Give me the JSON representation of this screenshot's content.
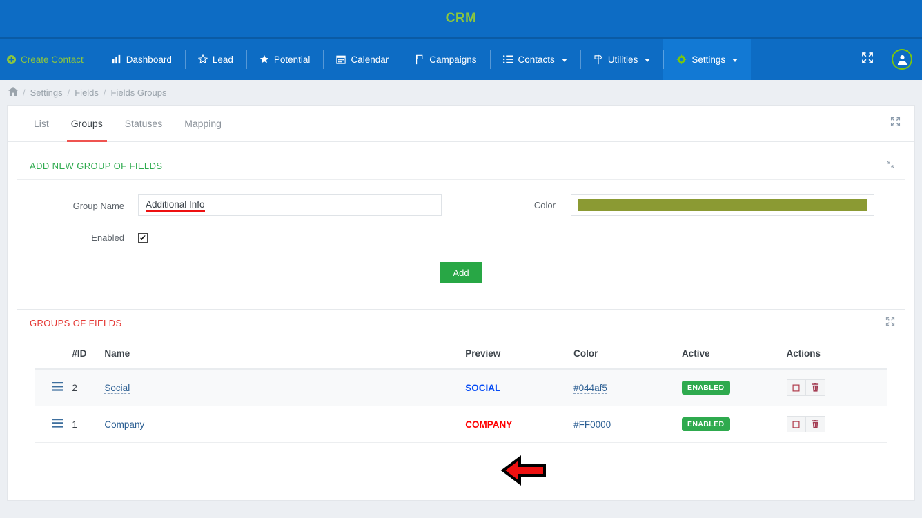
{
  "header": {
    "brand": "CRM",
    "brand_color": "#8cc63e",
    "bg_color": "#0d6cc4"
  },
  "nav": {
    "items": [
      {
        "label": "Create Contact",
        "icon": "plus-circle-icon",
        "active": false,
        "highlight": true
      },
      {
        "label": "Dashboard",
        "icon": "bar-chart-icon",
        "active": false
      },
      {
        "label": "Lead",
        "icon": "star-outline-icon",
        "active": false
      },
      {
        "label": "Potential",
        "icon": "star-filled-icon",
        "active": false
      },
      {
        "label": "Calendar",
        "icon": "calendar-icon",
        "active": false
      },
      {
        "label": "Campaigns",
        "icon": "flag-icon",
        "active": false
      },
      {
        "label": "Contacts",
        "icon": "list-icon",
        "caret": true,
        "active": false
      },
      {
        "label": "Utilities",
        "icon": "signpost-icon",
        "caret": true,
        "active": false
      },
      {
        "label": "Settings",
        "icon": "gear-icon",
        "caret": true,
        "active": true
      }
    ],
    "right": {
      "fullscreen_icon": "expand-arrows-icon",
      "avatar_icon": "user-avatar-icon"
    }
  },
  "breadcrumb": {
    "home_icon": "home-icon",
    "separator": "/",
    "items": [
      "Settings",
      "Fields",
      "Fields Groups"
    ]
  },
  "tabs": {
    "items": [
      {
        "label": "List",
        "active": false
      },
      {
        "label": "Groups",
        "active": true
      },
      {
        "label": "Statuses",
        "active": false
      },
      {
        "label": "Mapping",
        "active": false
      }
    ],
    "expand_icon": "expand-arrows-icon"
  },
  "add_form": {
    "title": "ADD NEW GROUP OF FIELDS",
    "title_color": "#2eaa4e",
    "collapse_icon": "collapse-arrows-icon",
    "group_name_label": "Group Name",
    "group_name_value": "Additional Info",
    "group_name_placeholder": "",
    "color_label": "Color",
    "color_value": "#8b9a33",
    "enabled_label": "Enabled",
    "enabled_checked": true,
    "checkbox_glyph": "✔",
    "add_button": "Add",
    "add_button_color": "#28a745",
    "annotation": {
      "type": "arrow-left",
      "fill": "#ee1111",
      "stroke": "#000000"
    }
  },
  "groups_table": {
    "title": "GROUPS OF FIELDS",
    "title_color": "#e53935",
    "expand_icon": "expand-arrows-icon",
    "columns": [
      "",
      "#ID",
      "Name",
      "Preview",
      "Color",
      "Active",
      "Actions"
    ],
    "rows": [
      {
        "handle_icon": "drag-handle-icon",
        "id": "2",
        "name": "Social",
        "preview": "SOCIAL",
        "preview_color": "#044af5",
        "color": "#044af5",
        "active": "ENABLED",
        "actions": [
          "edit-icon",
          "delete-icon"
        ]
      },
      {
        "handle_icon": "drag-handle-icon",
        "id": "1",
        "name": "Company",
        "preview": "COMPANY",
        "preview_color": "#FF0000",
        "color": "#FF0000",
        "active": "ENABLED",
        "actions": [
          "edit-icon",
          "delete-icon"
        ]
      }
    ]
  }
}
